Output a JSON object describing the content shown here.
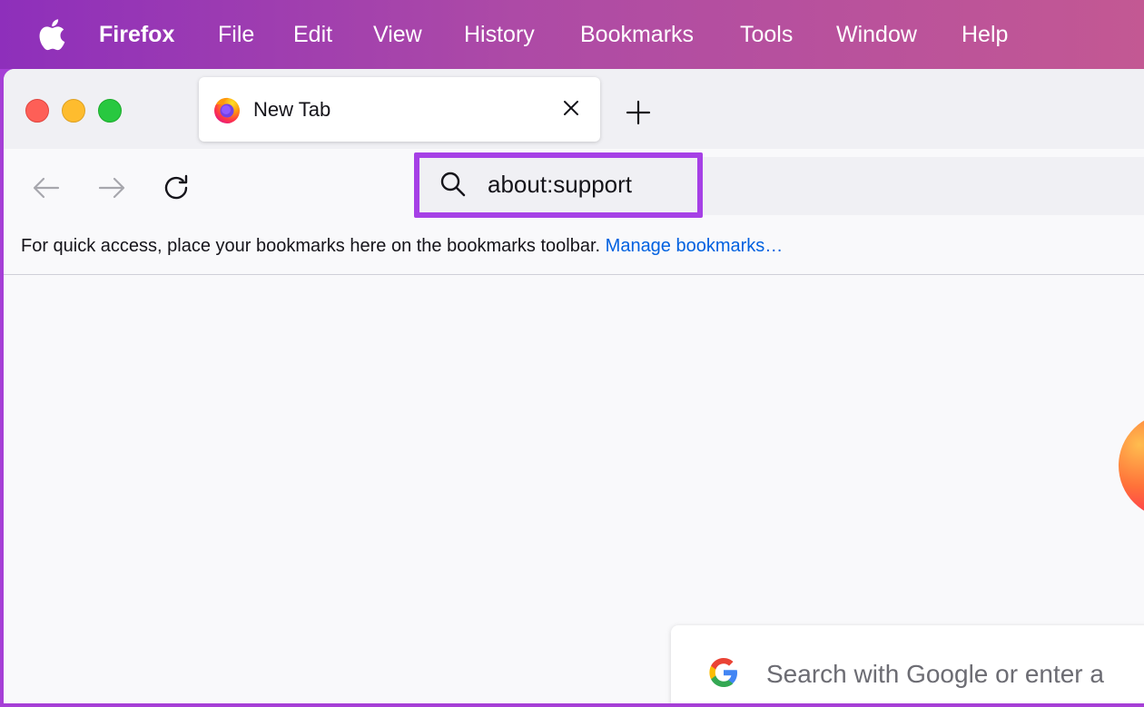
{
  "menubar": {
    "app_name": "Firefox",
    "items": [
      "File",
      "Edit",
      "View",
      "History",
      "Bookmarks",
      "Tools",
      "Window",
      "Help"
    ]
  },
  "tab": {
    "title": "New Tab",
    "icon": "firefox-icon"
  },
  "navbar": {
    "url": "about:support"
  },
  "bookmarks_toolbar": {
    "message": "For quick access, place your bookmarks here on the bookmarks toolbar.",
    "link": "Manage bookmarks…"
  },
  "newtab": {
    "search_placeholder": "Search with Google or enter a"
  },
  "colors": {
    "highlight": "#a640e6",
    "link": "#0061e0"
  }
}
